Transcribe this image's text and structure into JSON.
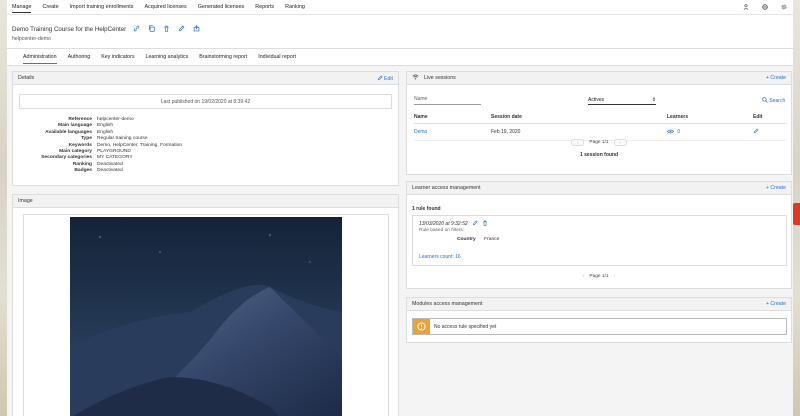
{
  "topnav": {
    "items": [
      "Manage",
      "Create",
      "Import training enrollments",
      "Acquired licenses",
      "Generated licenses",
      "Reports",
      "Ranking"
    ],
    "icons": [
      "user-icon",
      "globe-icon",
      "settings-icon"
    ]
  },
  "header": {
    "title": "Demo Training Course for the HelpCenter",
    "subtitle": "helpcenter-demo",
    "actions": [
      "link-icon",
      "copy-icon",
      "trash-icon",
      "edit-icon",
      "share-icon"
    ]
  },
  "tabs": [
    "Administration",
    "Authoring",
    "Key indicators",
    "Learning analytics",
    "Brainstorming report",
    "Individual report"
  ],
  "details": {
    "title": "Details",
    "edit_label": "Edit",
    "published": "Last published on 19/02/2020 at 8:39:42",
    "fields": [
      {
        "label": "Reference",
        "value": "helpcenter-demo"
      },
      {
        "label": "Main language",
        "value": "English"
      },
      {
        "label": "Available languages",
        "value": "English"
      },
      {
        "label": "Type",
        "value": "Regular training course"
      },
      {
        "label": "Keywords",
        "value": "Demo, HelpCenter, Training, Formation"
      },
      {
        "label": "Main category",
        "value": "PLAYGROUND"
      },
      {
        "label": "Secondary categories",
        "value": "MY CATEGORY"
      },
      {
        "label": "Ranking",
        "value": "Deactivated"
      },
      {
        "label": "Badges",
        "value": "Deactivated"
      }
    ]
  },
  "image_panel": {
    "title": "Image"
  },
  "live_sessions": {
    "title": "Live​ sessions",
    "create_label": "Create",
    "name_placeholder": "Name",
    "filter_value": "Actives",
    "search_label": "Search",
    "columns": [
      "Name",
      "Session date",
      "Learners",
      "Edit"
    ],
    "rows": [
      {
        "name": "Demo",
        "date": "Feb 19, 2020",
        "learners": "0"
      }
    ],
    "page": "Page 1/1",
    "count": "1 session found"
  },
  "learner_access": {
    "title": "Learner access management",
    "create_label": "Create",
    "rules_found": "1 rule found",
    "rule_date": "13/03/2020 at 9:32:52",
    "rule_desc": "Rule based on filters:",
    "filter_label": "Country",
    "filter_value": "France",
    "learners_count": "Learners count: 16",
    "page": "Page 1/1"
  },
  "modules_access": {
    "title": "Modules access management",
    "create_label": "Create",
    "empty_message": "No access rule specified yet"
  },
  "colors": {
    "accent": "#2a6fd6",
    "tab_underline": "#d04a1f",
    "warning": "#e8a33a",
    "side_tab": "#d93b2b"
  }
}
